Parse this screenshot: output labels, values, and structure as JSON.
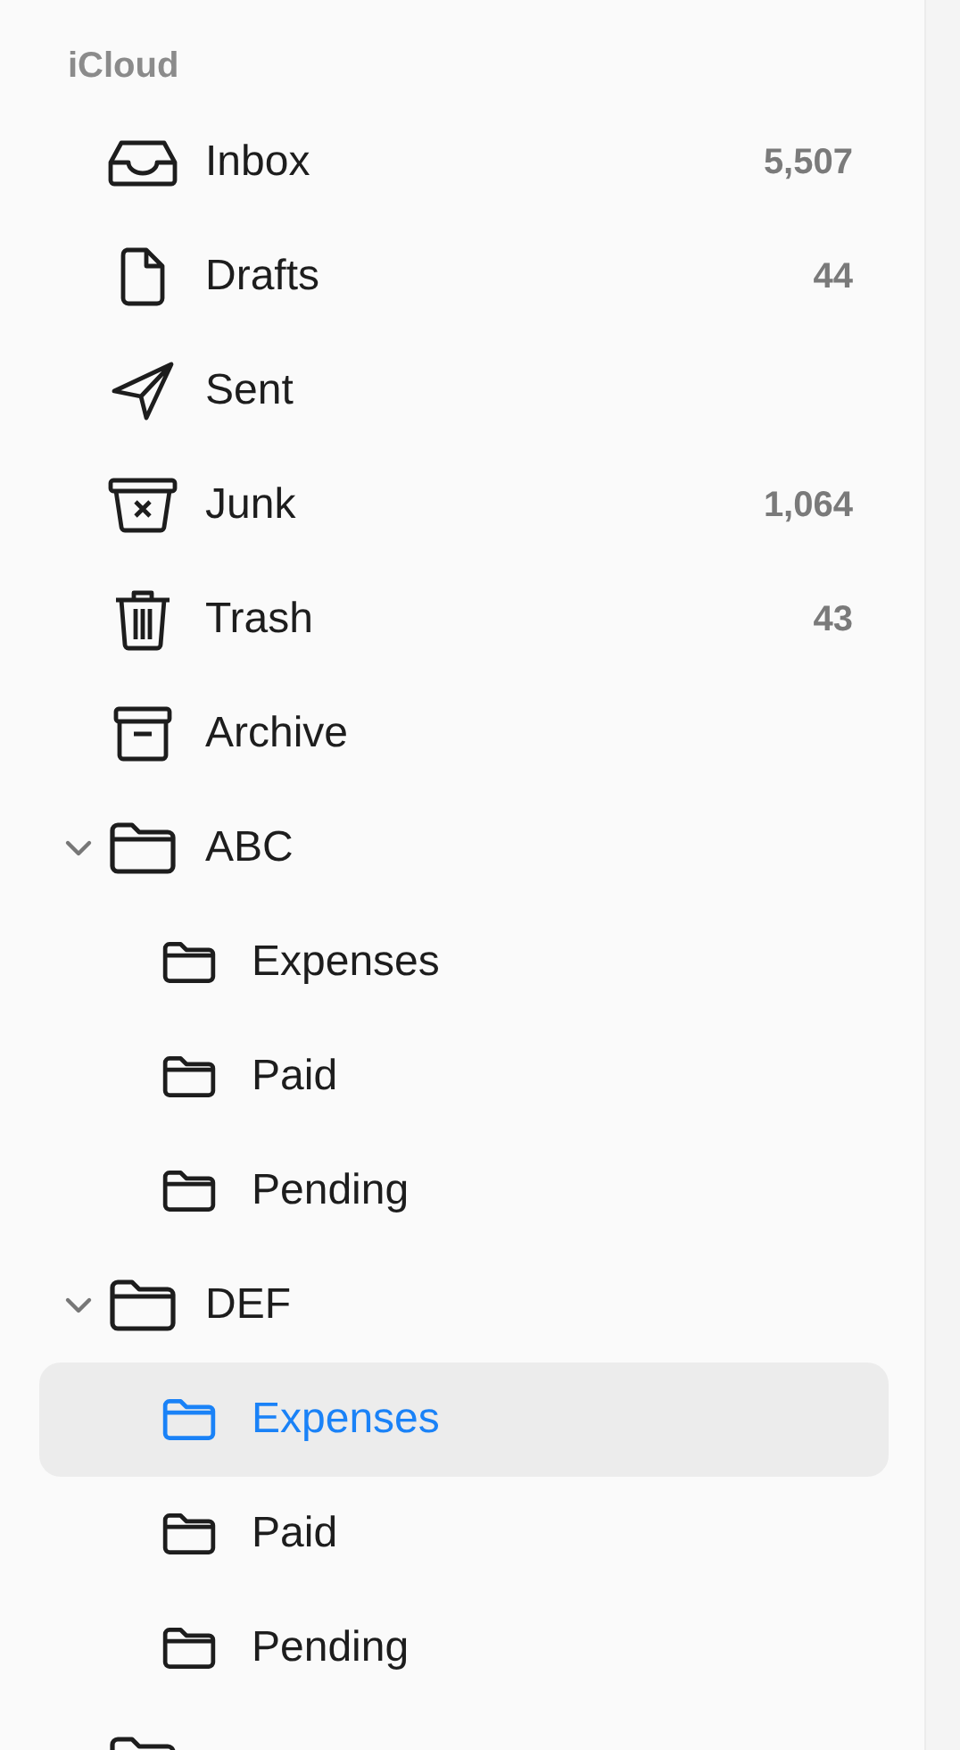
{
  "sidebar": {
    "section_title": "iCloud",
    "items": [
      {
        "kind": "inbox",
        "label": "Inbox",
        "count": "5,507",
        "selected": false
      },
      {
        "kind": "drafts",
        "label": "Drafts",
        "count": "44",
        "selected": false
      },
      {
        "kind": "sent",
        "label": "Sent",
        "selected": false
      },
      {
        "kind": "junk",
        "label": "Junk",
        "count": "1,064",
        "selected": false
      },
      {
        "kind": "trash",
        "label": "Trash",
        "count": "43",
        "selected": false
      },
      {
        "kind": "archive",
        "label": "Archive",
        "selected": false
      },
      {
        "kind": "folder",
        "label": "ABC",
        "expanded": true,
        "selected": false,
        "children": [
          {
            "kind": "folder",
            "label": "Expenses",
            "selected": false
          },
          {
            "kind": "folder",
            "label": "Paid",
            "selected": false
          },
          {
            "kind": "folder",
            "label": "Pending",
            "selected": false
          }
        ]
      },
      {
        "kind": "folder",
        "label": "DEF",
        "expanded": true,
        "selected": false,
        "children": [
          {
            "kind": "folder",
            "label": "Expenses",
            "selected": true
          },
          {
            "kind": "folder",
            "label": "Paid",
            "selected": false
          },
          {
            "kind": "folder",
            "label": "Pending",
            "selected": false
          }
        ]
      },
      {
        "kind": "folder",
        "selected": false
      }
    ]
  }
}
